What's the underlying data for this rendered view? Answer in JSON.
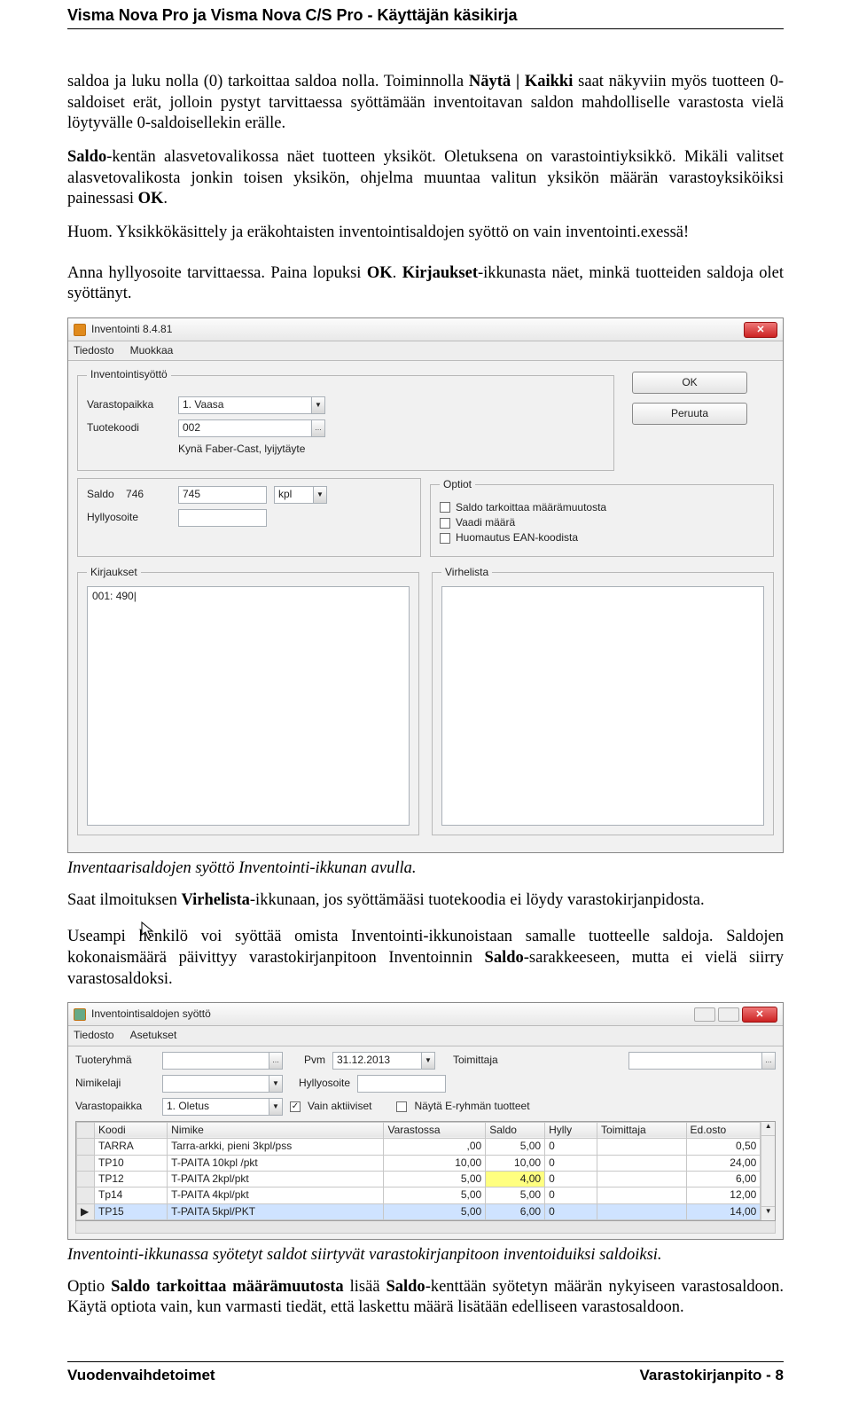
{
  "header": {
    "title": "Visma Nova Pro ja Visma Nova C/S Pro - Käyttäjän käsikirja"
  },
  "para": {
    "p1a": "saldoa ja luku nolla (0) tarkoittaa saldoa nolla. Toiminnolla ",
    "p1b": "Näytä | Kaikki",
    "p1c": " saat näkyviin myös tuotteen 0-saldoiset erät, jolloin pystyt tarvittaessa syöttämään inventoitavan saldon mahdolliselle varastosta vielä löytyvälle 0-saldoisellekin erälle.",
    "p2a": "Saldo",
    "p2b": "-kentän alasvetovalikossa näet tuotteen yksiköt. Oletuksena on varastointiyksikkö. Mikäli valitset alasvetovalikosta jonkin toisen yksikön, ohjelma muuntaa valitun yksikön määrän varastoyksiköiksi painessasi ",
    "p2c": "OK",
    "p2d": ".",
    "p3": "Huom. Yksikkökäsittely ja eräkohtaisten inventointisaldojen syöttö on vain inventointi.exessä!",
    "p4a": "Anna hyllyosoite tarvittaessa. Paina lopuksi ",
    "p4b": "OK",
    "p4c": ". ",
    "p4d": "Kirjaukset",
    "p4e": "-ikkunasta näet, minkä tuotteiden saldoja olet syöttänyt.",
    "cap1": "Inventaarisaldojen syöttö Inventointi-ikkunan avulla.",
    "p5a": "Saat ilmoituksen ",
    "p5b": "Virhelista",
    "p5c": "-ikkunaan, jos syöttämääsi tuotekoodia ei löydy varastokirjanpidosta.",
    "p6a": "Useampi henkilö voi syöttää omista Inventointi-ikkunoistaan samalle tuotteelle saldoja. Saldojen kokonaismäärä päivittyy varastokirjanpitoon Inventoinnin ",
    "p6b": "Saldo",
    "p6c": "-sarakkeeseen, mutta ei vielä siirry varastosaldoksi.",
    "cap2": "Inventointi-ikkunassa syötetyt saldot siirtyvät varastokirjanpitoon inventoiduiksi saldoiksi.",
    "p7a": "Optio ",
    "p7b": "Saldo tarkoittaa määrämuutosta",
    "p7c": " lisää ",
    "p7d": "Saldo",
    "p7e": "-kenttään syötetyn määrän nykyiseen varastosaldoon. Käytä optiota vain, kun varmasti tiedät, että laskettu määrä lisätään edelliseen varastosaldoon."
  },
  "win1": {
    "title": "Inventointi 8.4.81",
    "menu": {
      "m1": "Tiedosto",
      "m2": "Muokkaa"
    },
    "legend_syotto": "Inventointisyöttö",
    "lbl_varasto": "Varastopaikka",
    "val_varasto": "1. Vaasa",
    "lbl_tuote": "Tuotekoodi",
    "val_tuote": "002",
    "tuote_nimi": "Kynä Faber-Cast, lyijytäyte",
    "lbl_saldo": "Saldo",
    "val_saldo_prev": "746",
    "val_saldo": "745",
    "val_unit": "kpl",
    "lbl_hylly": "Hyllyosoite",
    "btn_ok": "OK",
    "btn_cancel": "Peruuta",
    "legend_optiot": "Optiot",
    "opt1": "Saldo tarkoittaa määrämuutosta",
    "opt2": "Vaadi määrä",
    "opt3": "Huomautus EAN-koodista",
    "legend_kirj": "Kirjaukset",
    "kirj_item": "001: 490|",
    "legend_virhe": "Virhelista"
  },
  "win2": {
    "title": "Inventointisaldojen syöttö",
    "menu": {
      "m1": "Tiedosto",
      "m2": "Asetukset"
    },
    "lbl_tuoteryhma": "Tuoteryhmä",
    "lbl_pvm": "Pvm",
    "val_pvm": "31.12.2013",
    "lbl_toimittaja": "Toimittaja",
    "lbl_nimikelaji": "Nimikelaji",
    "lbl_hylly": "Hyllyosoite",
    "lbl_varasto": "Varastopaikka",
    "val_varasto": "1. Oletus",
    "chk_aktiiviset": "Vain aktiiviset",
    "chk_eryhma": "Näytä E-ryhmän tuotteet",
    "cols": {
      "c1": "Koodi",
      "c2": "Nimike",
      "c3": "Varastossa",
      "c4": "Saldo",
      "c5": "Hylly",
      "c6": "Toimittaja",
      "c7": "Ed.osto"
    },
    "rows": [
      {
        "koodi": "TARRA",
        "nimike": "Tarra-arkki, pieni 3kpl/pss",
        "varasto": ",00",
        "saldo": "5,00",
        "hylly": "0",
        "toim": "",
        "edosto": "0,50"
      },
      {
        "koodi": "TP10",
        "nimike": "T-PAITA 10kpl /pkt",
        "varasto": "10,00",
        "saldo": "10,00",
        "hylly": "0",
        "toim": "",
        "edosto": "24,00"
      },
      {
        "koodi": "TP12",
        "nimike": "T-PAITA 2kpl/pkt",
        "varasto": "5,00",
        "saldo": "4,00",
        "hylly": "0",
        "toim": "",
        "edosto": "6,00"
      },
      {
        "koodi": "Tp14",
        "nimike": "T-PAITA 4kpl/pkt",
        "varasto": "5,00",
        "saldo": "5,00",
        "hylly": "0",
        "toim": "",
        "edosto": "12,00"
      },
      {
        "koodi": "TP15",
        "nimike": "T-PAITA 5kpl/PKT",
        "varasto": "5,00",
        "saldo": "6,00",
        "hylly": "0",
        "toim": "",
        "edosto": "14,00"
      }
    ]
  },
  "footer": {
    "left": "Vuodenvaihdetoimet",
    "right": "Varastokirjanpito - 8"
  }
}
